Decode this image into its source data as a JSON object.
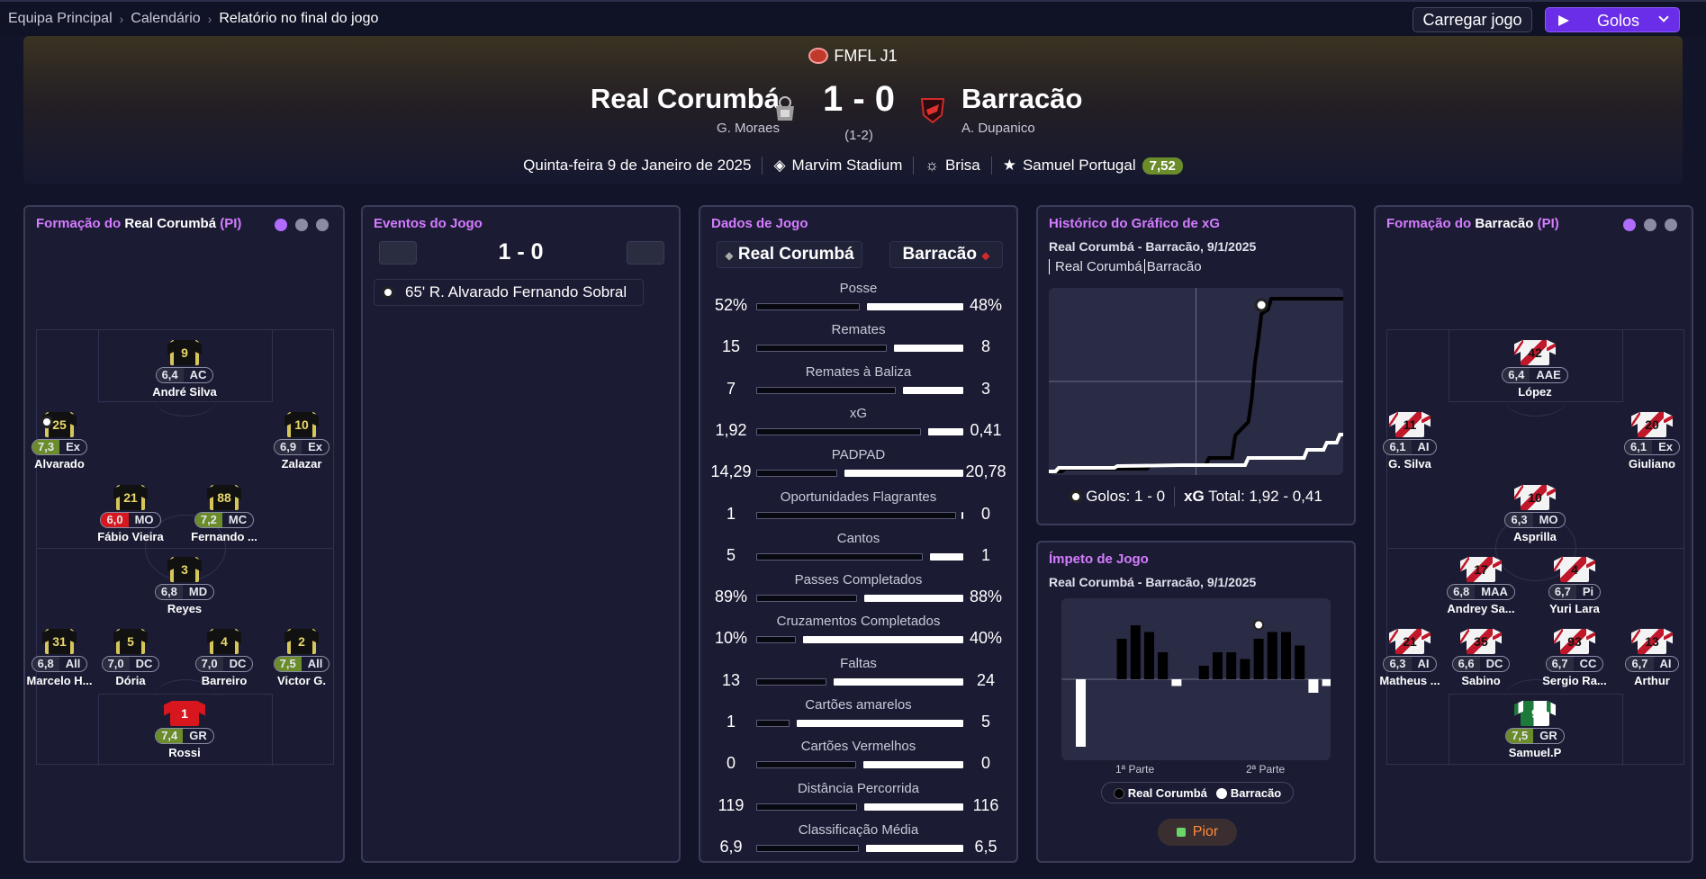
{
  "breadcrumb": [
    "Equipa Principal",
    "Calendário",
    "Relatório no final do jogo"
  ],
  "buttons": {
    "load": "Carregar jogo",
    "highlights": "Golos"
  },
  "match": {
    "competition": "FMFL J1",
    "home": {
      "name": "Real Corumbá",
      "manager": "G. Moraes"
    },
    "away": {
      "name": "Barracão",
      "manager": "A. Dupanico"
    },
    "score": "1 - 0",
    "aggregate": "(1-2)",
    "date": "Quinta-feira 9 de Janeiro de 2025",
    "stadium": "Marvim Stadium",
    "weather": "Brisa",
    "pom": {
      "name": "Samuel Portugal",
      "rating": "7,52"
    }
  },
  "home_lineup": {
    "title_prefix": "Formação do ",
    "team": "Real Corumbá",
    "suffix": " (PI)",
    "players": [
      {
        "num": "9",
        "rating": "6,4",
        "pos": "AC",
        "name": "André Silva",
        "color": "none"
      },
      {
        "num": "25",
        "rating": "7,3",
        "pos": "Ex",
        "name": "Alvarado",
        "color": "green"
      },
      {
        "num": "10",
        "rating": "6,9",
        "pos": "Ex",
        "name": "Zalazar",
        "color": "none"
      },
      {
        "num": "21",
        "rating": "6,0",
        "pos": "MO",
        "name": "Fábio Vieira",
        "color": "red"
      },
      {
        "num": "88",
        "rating": "7,2",
        "pos": "MC",
        "name": "Fernando ...",
        "color": "green"
      },
      {
        "num": "3",
        "rating": "6,8",
        "pos": "MD",
        "name": "Reyes",
        "color": "none"
      },
      {
        "num": "31",
        "rating": "6,8",
        "pos": "All",
        "name": "Marcelo H...",
        "color": "none"
      },
      {
        "num": "5",
        "rating": "7,0",
        "pos": "DC",
        "name": "Dória",
        "color": "none"
      },
      {
        "num": "4",
        "rating": "7,0",
        "pos": "DC",
        "name": "Barreiro",
        "color": "none"
      },
      {
        "num": "2",
        "rating": "7,5",
        "pos": "All",
        "name": "Victor G.",
        "color": "green"
      },
      {
        "num": "1",
        "rating": "7,4",
        "pos": "GR",
        "name": "Rossi",
        "color": "green"
      }
    ]
  },
  "away_lineup": {
    "title_prefix": "Formação do ",
    "team": "Barracão",
    "suffix": " (PI)",
    "players": [
      {
        "num": "42",
        "rating": "6,4",
        "pos": "AAE",
        "name": "López",
        "color": "none"
      },
      {
        "num": "11",
        "rating": "6,1",
        "pos": "AI",
        "name": "G. Silva",
        "color": "none"
      },
      {
        "num": "20",
        "rating": "6,1",
        "pos": "Ex",
        "name": "Giuliano",
        "color": "none"
      },
      {
        "num": "10",
        "rating": "6,3",
        "pos": "MO",
        "name": "Asprilla",
        "color": "none"
      },
      {
        "num": "17",
        "rating": "6,8",
        "pos": "MAA",
        "name": "Andrey Sa...",
        "color": "none"
      },
      {
        "num": "4",
        "rating": "6,7",
        "pos": "Pi",
        "name": "Yuri Lara",
        "color": "none"
      },
      {
        "num": "21",
        "rating": "6,3",
        "pos": "AI",
        "name": "Matheus ...",
        "color": "none"
      },
      {
        "num": "35",
        "rating": "6,6",
        "pos": "DC",
        "name": "Sabino",
        "color": "none"
      },
      {
        "num": "93",
        "rating": "6,7",
        "pos": "CC",
        "name": "Sergio Ra...",
        "color": "none"
      },
      {
        "num": "13",
        "rating": "6,7",
        "pos": "AI",
        "name": "Arthur",
        "color": "none"
      },
      {
        "num": "9",
        "rating": "7,5",
        "pos": "GR",
        "name": "Samuel.P",
        "color": "green"
      }
    ]
  },
  "events": {
    "title": "Eventos do Jogo",
    "score": "1 - 0",
    "items": [
      {
        "minute": "65'",
        "scorer": "R. Alvarado",
        "assist": "Fernando Sobral"
      }
    ]
  },
  "stats": {
    "title": "Dados de Jogo",
    "home_label": "Real Corumbá",
    "away_label": "Barracão",
    "rows": [
      {
        "label": "Posse",
        "home": "52%",
        "away": "48%",
        "hv": 52,
        "av": 48
      },
      {
        "label": "Remates",
        "home": "15",
        "away": "8",
        "hv": 15,
        "av": 8
      },
      {
        "label": "Remates à Baliza",
        "home": "7",
        "away": "3",
        "hv": 7,
        "av": 3
      },
      {
        "label": "xG",
        "home": "1,92",
        "away": "0,41",
        "hv": 1.92,
        "av": 0.41
      },
      {
        "label": "PADPAD",
        "home": "14,29",
        "away": "20,78",
        "hv": 14.29,
        "av": 20.78
      },
      {
        "label": "Oportunidades Flagrantes",
        "home": "1",
        "away": "0",
        "hv": 1,
        "av": 0
      },
      {
        "label": "Cantos",
        "home": "5",
        "away": "1",
        "hv": 5,
        "av": 1
      },
      {
        "label": "Passes Completados",
        "home": "89%",
        "away": "88%",
        "hv": 89,
        "av": 88
      },
      {
        "label": "Cruzamentos Completados",
        "home": "10%",
        "away": "40%",
        "hv": 10,
        "av": 40
      },
      {
        "label": "Faltas",
        "home": "13",
        "away": "24",
        "hv": 13,
        "av": 24
      },
      {
        "label": "Cartões amarelos",
        "home": "1",
        "away": "5",
        "hv": 1,
        "av": 5
      },
      {
        "label": "Cartões Vermelhos",
        "home": "0",
        "away": "0",
        "hv": 0,
        "av": 0
      },
      {
        "label": "Distância Percorrida",
        "home": "119",
        "away": "116",
        "hv": 119,
        "av": 116
      },
      {
        "label": "Classificação Média",
        "home": "6,9",
        "away": "6,5",
        "hv": 6.9,
        "av": 6.5
      }
    ]
  },
  "xg_chart": {
    "title": "Histórico do Gráfico de xG",
    "subtitle": "Real Corumbá - Barracão, 9/1/2025",
    "legend_home": "Real Corumbá",
    "legend_away": "Barracão",
    "goals_text": "Golos: 1 - 0",
    "xg_label": "xG",
    "xg_total": "Total: 1,92 - 0,41"
  },
  "momentum": {
    "title": "Ímpeto de Jogo",
    "subtitle": "Real Corumbá - Barracão, 9/1/2025",
    "half1": "1ª Parte",
    "half2": "2ª Parte",
    "legend_home": "Real Corumbá",
    "legend_away": "Barracão",
    "button": "Pior"
  },
  "chart_data": [
    {
      "type": "line",
      "title": "Histórico do Gráfico de xG",
      "xlabel": "",
      "ylabel": "",
      "series": [
        {
          "name": "Real Corumbá",
          "x": [
            0,
            4,
            5,
            30,
            31,
            48,
            49,
            56,
            57,
            61,
            62,
            63,
            64,
            65,
            67,
            68,
            90
          ],
          "values": [
            0,
            0,
            0.03,
            0.03,
            0.07,
            0.07,
            0.15,
            0.15,
            0.4,
            0.55,
            0.8,
            1.2,
            1.45,
            1.75,
            1.8,
            1.92,
            1.92
          ]
        },
        {
          "name": "Barracão",
          "x": [
            0,
            2,
            3,
            20,
            21,
            40,
            60,
            61,
            78,
            79,
            84,
            85,
            88,
            89,
            90
          ],
          "values": [
            0,
            0,
            0.04,
            0.04,
            0.06,
            0.07,
            0.07,
            0.15,
            0.15,
            0.24,
            0.24,
            0.32,
            0.32,
            0.41,
            0.41
          ]
        }
      ],
      "annotations": [
        "goal"
      ]
    },
    {
      "type": "bar",
      "title": "Ímpeto de Jogo",
      "xlabel": "",
      "categories": [
        "1ª Parte",
        "2ª Parte"
      ],
      "values": [
        -10,
        0,
        0,
        6,
        8,
        7,
        4,
        -1,
        0,
        2,
        4,
        4,
        3,
        6,
        7,
        7,
        5,
        -2,
        -1,
        4
      ]
    }
  ]
}
